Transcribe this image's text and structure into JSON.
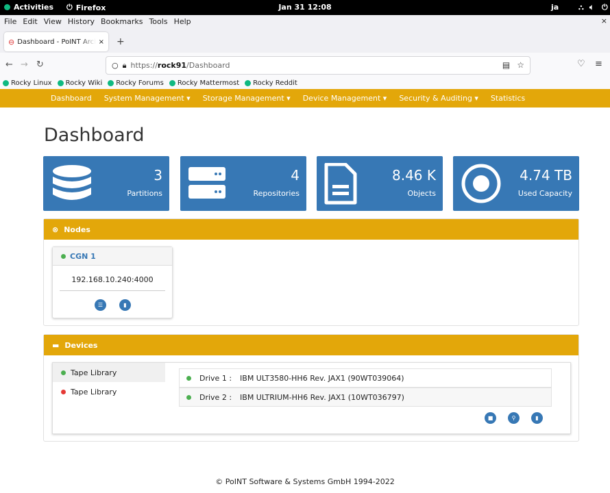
{
  "topbar": {
    "activities": "Activities",
    "app": "Firefox",
    "clock": "Jan 31  12:08",
    "lang": "ja"
  },
  "menubar": {
    "items": [
      "File",
      "Edit",
      "View",
      "History",
      "Bookmarks",
      "Tools",
      "Help"
    ]
  },
  "tab": {
    "title": "Dashboard - PoINT Archiv"
  },
  "urlbar": {
    "prefix": "https://",
    "host": "rock91",
    "path": "/Dashboard"
  },
  "bookmarks": [
    "Rocky Linux",
    "Rocky Wiki",
    "Rocky Forums",
    "Rocky Mattermost",
    "Rocky Reddit"
  ],
  "appnav": [
    "Dashboard",
    "System Management ▾",
    "Storage Management ▾",
    "Device Management ▾",
    "Security & Auditing ▾",
    "Statistics"
  ],
  "page": {
    "title": "Dashboard"
  },
  "stats": [
    {
      "value": "3",
      "label": "Partitions"
    },
    {
      "value": "4",
      "label": "Repositories"
    },
    {
      "value": "8.46 K",
      "label": "Objects"
    },
    {
      "value": "4.74 TB",
      "label": "Used Capacity"
    }
  ],
  "nodes": {
    "title": "Nodes",
    "node": {
      "name": "CGN 1",
      "address": "192.168.10.240:4000",
      "status_color": "#4caf50"
    }
  },
  "devices": {
    "title": "Devices",
    "libraries": [
      {
        "name": "Tape Library",
        "status": "green"
      },
      {
        "name": "Tape Library",
        "status": "red"
      }
    ],
    "drives": [
      {
        "label": "Drive 1 :",
        "desc": "IBM ULT3580-HH6 Rev. JAX1 (90WT039064)"
      },
      {
        "label": "Drive 2 :",
        "desc": "IBM ULTRIUM-HH6 Rev. JAX1 (10WT036797)"
      }
    ]
  },
  "footer": {
    "text": "© PoINT Software & Systems GmbH 1994-2022"
  },
  "colors": {
    "accent": "#e3a70a",
    "card": "#3778b5"
  }
}
